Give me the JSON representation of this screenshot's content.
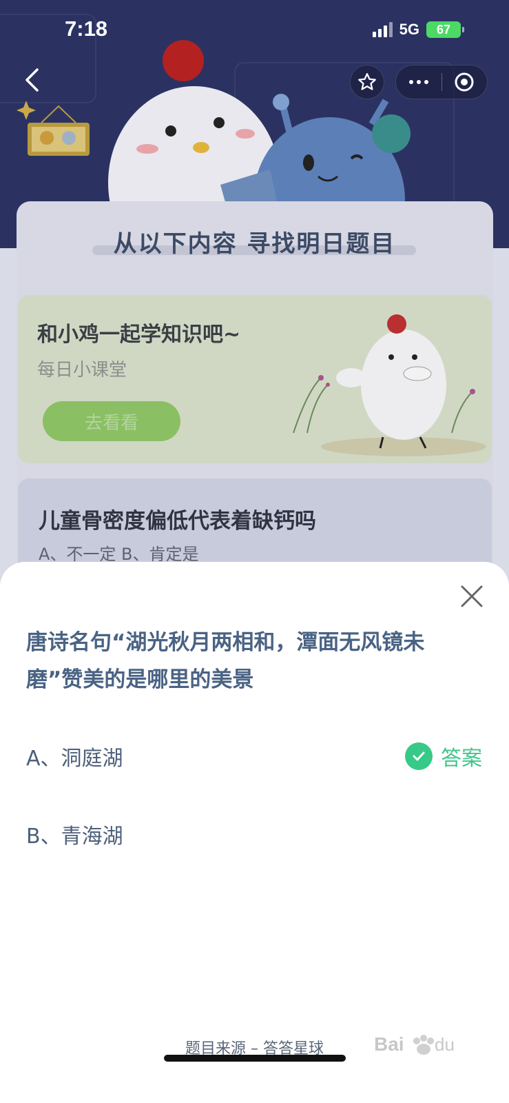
{
  "status_bar": {
    "time": "7:18",
    "network": "5G",
    "battery": "67"
  },
  "background": {
    "title": "从以下内容 寻找明日题目",
    "learn_card": {
      "title": "和小鸡一起学知识吧~",
      "subtitle": "每日小课堂",
      "button_label": "去看看"
    },
    "question_card": {
      "title": "儿童骨密度偏低代表着缺钙吗",
      "options": "A、不一定    B、肯定是"
    }
  },
  "sheet": {
    "question": "唐诗名句“湖光秋月两相和，潭面无风镜未磨”赞美的是哪里的美景",
    "options": [
      {
        "label": "A、洞庭湖",
        "is_answer": true
      },
      {
        "label": "B、青海湖",
        "is_answer": false
      }
    ],
    "answer_label": "答案",
    "source": "题目来源 – 答答星球"
  },
  "colors": {
    "question_text": "#4a6384",
    "answer_green": "#3fc58a",
    "check_bg": "#37c988",
    "hero_bg": "#2b3262"
  },
  "icons": [
    "back-arrow-icon",
    "star-icon",
    "more-dots-icon",
    "target-icon",
    "close-icon",
    "check-icon",
    "baidu-watermark-icon"
  ]
}
